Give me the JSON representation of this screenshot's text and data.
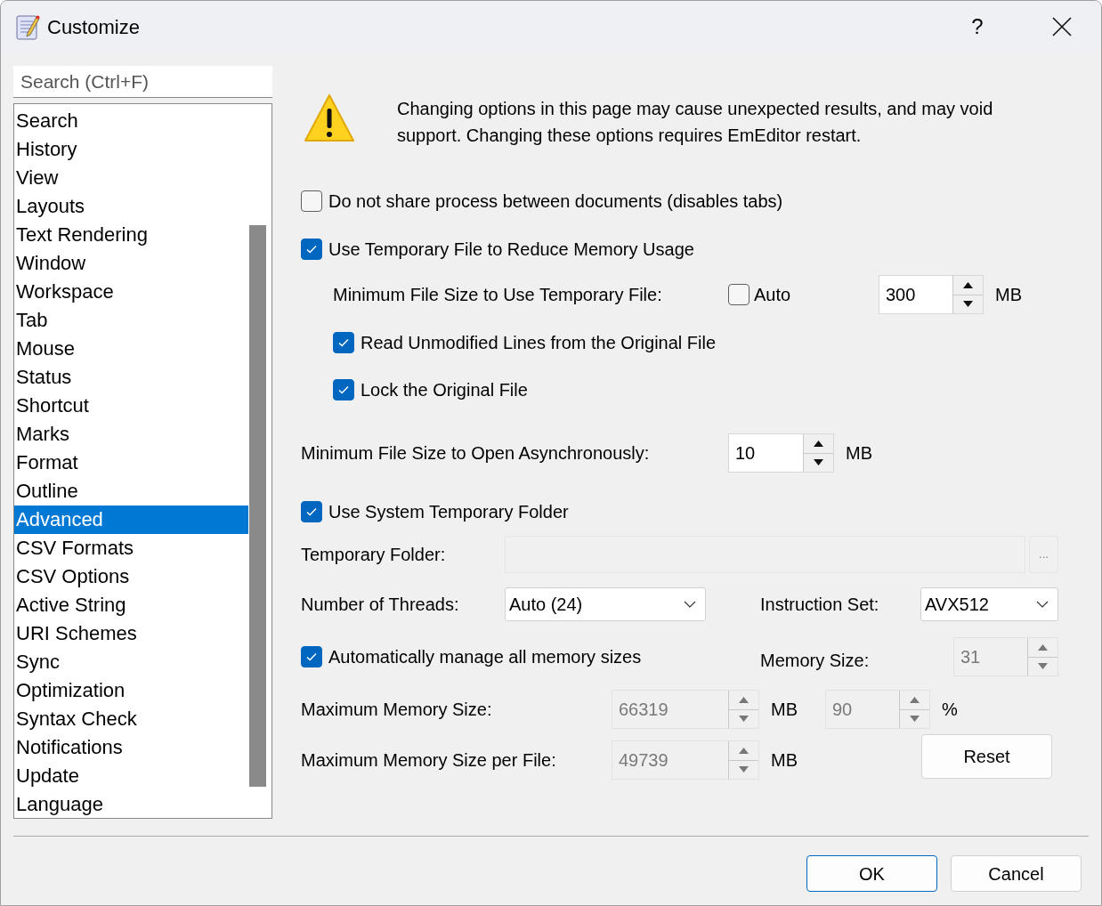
{
  "window": {
    "title": "Customize",
    "help": "?"
  },
  "search": {
    "placeholder": "Search (Ctrl+F)"
  },
  "sidebar": {
    "items": [
      {
        "label": "Search",
        "selected": false
      },
      {
        "label": "History",
        "selected": false
      },
      {
        "label": "View",
        "selected": false
      },
      {
        "label": "Layouts",
        "selected": false
      },
      {
        "label": "Text Rendering",
        "selected": false
      },
      {
        "label": "Window",
        "selected": false
      },
      {
        "label": "Workspace",
        "selected": false
      },
      {
        "label": "Tab",
        "selected": false
      },
      {
        "label": "Mouse",
        "selected": false
      },
      {
        "label": "Status",
        "selected": false
      },
      {
        "label": "Shortcut",
        "selected": false
      },
      {
        "label": "Marks",
        "selected": false
      },
      {
        "label": "Format",
        "selected": false
      },
      {
        "label": "Outline",
        "selected": false
      },
      {
        "label": "Advanced",
        "selected": true
      },
      {
        "label": "CSV Formats",
        "selected": false
      },
      {
        "label": "CSV Options",
        "selected": false
      },
      {
        "label": "Active String",
        "selected": false
      },
      {
        "label": "URI Schemes",
        "selected": false
      },
      {
        "label": "Sync",
        "selected": false
      },
      {
        "label": "Optimization",
        "selected": false
      },
      {
        "label": "Syntax Check",
        "selected": false
      },
      {
        "label": "Notifications",
        "selected": false
      },
      {
        "label": "Update",
        "selected": false
      },
      {
        "label": "Language",
        "selected": false
      }
    ]
  },
  "warning": "Changing options in this page may cause unexpected results, and may void support. Changing these options requires EmEditor restart.",
  "share_process": {
    "label": "Do not share process between documents (disables tabs)",
    "checked": false
  },
  "temp_file": {
    "label": "Use Temporary File to Reduce Memory Usage",
    "checked": true
  },
  "min_temp_size": {
    "label": "Minimum File Size to Use Temporary File:",
    "auto": {
      "label": "Auto",
      "checked": false
    },
    "value": "300",
    "unit": "MB",
    "disabled": false
  },
  "read_unmodified": {
    "label": "Read Unmodified Lines from the Original File",
    "checked": true
  },
  "lock_original": {
    "label": "Lock the Original File",
    "checked": true
  },
  "async_size": {
    "label": "Minimum File Size to Open Asynchronously:",
    "value": "10",
    "unit": "MB",
    "disabled": false
  },
  "system_temp": {
    "label": "Use System Temporary Folder",
    "checked": true
  },
  "temp_folder": {
    "label": "Temporary Folder:",
    "browse": "...",
    "disabled": true
  },
  "threads": {
    "label": "Number of Threads:",
    "value": "Auto (24)"
  },
  "instruction_set": {
    "label": "Instruction Set:",
    "value": "AVX512"
  },
  "auto_memory": {
    "label": "Automatically manage all memory sizes",
    "checked": true
  },
  "memory_size": {
    "label": "Memory Size:",
    "value": "31",
    "disabled": true
  },
  "max_memory": {
    "label": "Maximum Memory Size:",
    "value": "66319",
    "unit": "MB",
    "disabled": true,
    "percent": {
      "value": "90",
      "unit": "%",
      "disabled": true
    }
  },
  "max_memory_per_file": {
    "label": "Maximum Memory Size per File:",
    "value": "49739",
    "unit": "MB",
    "disabled": true
  },
  "reset": "Reset",
  "buttons": [
    {
      "label": "OK",
      "default": true
    },
    {
      "label": "Cancel",
      "default": false
    }
  ]
}
